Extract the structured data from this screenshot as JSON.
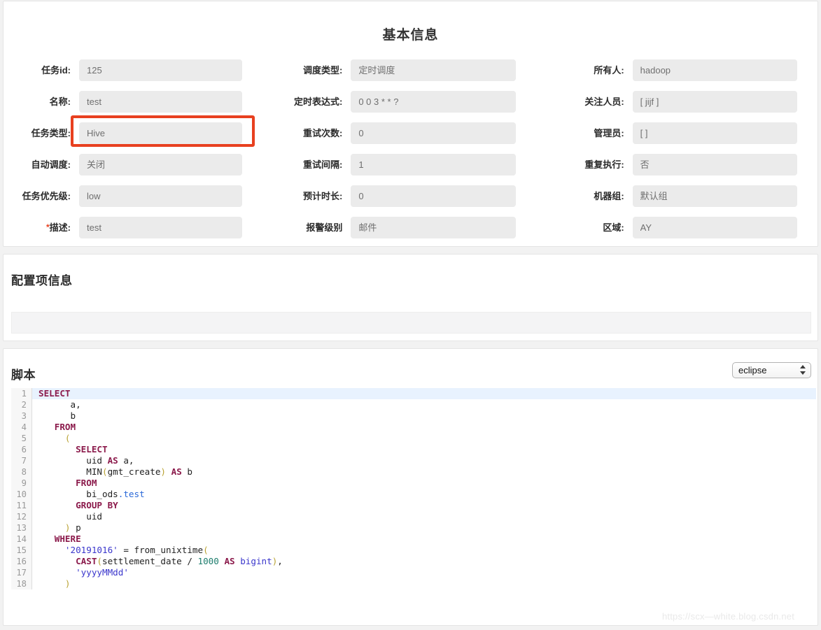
{
  "basic": {
    "title": "基本信息",
    "columns": [
      [
        {
          "label": "任务id:",
          "value": "125",
          "required": false,
          "name": "task-id"
        },
        {
          "label": "名称:",
          "value": "test",
          "required": false,
          "name": "task-name"
        },
        {
          "label": "任务类型:",
          "value": "Hive",
          "required": false,
          "name": "task-type"
        },
        {
          "label": "自动调度:",
          "value": "关闭",
          "required": false,
          "name": "auto-schedule"
        },
        {
          "label": "任务优先级:",
          "value": "low",
          "required": false,
          "name": "task-priority"
        },
        {
          "label": "描述:",
          "value": "test",
          "required": true,
          "name": "description"
        }
      ],
      [
        {
          "label": "调度类型:",
          "value": "定时调度",
          "required": false,
          "name": "schedule-type"
        },
        {
          "label": "定时表达式:",
          "value": "0 0 3 * * ?",
          "required": false,
          "name": "cron-expression"
        },
        {
          "label": "重试次数:",
          "value": "0",
          "required": false,
          "name": "retry-count"
        },
        {
          "label": "重试间隔:",
          "value": "1",
          "required": false,
          "name": "retry-interval"
        },
        {
          "label": "预计时长:",
          "value": "0",
          "required": false,
          "name": "estimated-duration"
        },
        {
          "label": "报警级别",
          "value": "邮件",
          "required": false,
          "name": "alarm-level"
        }
      ],
      [
        {
          "label": "所有人:",
          "value": "hadoop",
          "required": false,
          "name": "owner"
        },
        {
          "label": "关注人员:",
          "value": "[ jijf ]",
          "required": false,
          "name": "followers"
        },
        {
          "label": "管理员:",
          "value": "[ ]",
          "required": false,
          "name": "administrators"
        },
        {
          "label": "重复执行:",
          "value": "否",
          "required": false,
          "name": "repeat-execution"
        },
        {
          "label": "机器组:",
          "value": "默认组",
          "required": false,
          "name": "machine-group"
        },
        {
          "label": "区域:",
          "value": "AY",
          "required": false,
          "name": "region"
        }
      ]
    ],
    "highlight_color": "#e8401f"
  },
  "config": {
    "title": "配置项信息"
  },
  "script": {
    "title": "脚本",
    "theme": {
      "selected": "eclipse",
      "options": [
        "eclipse"
      ]
    },
    "code_lines": [
      {
        "n": "1",
        "tokens": [
          {
            "t": "SELECT",
            "c": "kw"
          }
        ]
      },
      {
        "n": "2",
        "tokens": [
          {
            "t": "      a,",
            "c": "fn"
          }
        ]
      },
      {
        "n": "3",
        "tokens": [
          {
            "t": "      b",
            "c": "fn"
          }
        ]
      },
      {
        "n": "4",
        "tokens": [
          {
            "t": "   ",
            "c": "fn"
          },
          {
            "t": "FROM",
            "c": "kw"
          }
        ]
      },
      {
        "n": "5",
        "tokens": [
          {
            "t": "     ",
            "c": "fn"
          },
          {
            "t": "(",
            "c": "par"
          }
        ]
      },
      {
        "n": "6",
        "tokens": [
          {
            "t": "       ",
            "c": "fn"
          },
          {
            "t": "SELECT",
            "c": "kw"
          }
        ]
      },
      {
        "n": "7",
        "tokens": [
          {
            "t": "         uid ",
            "c": "fn"
          },
          {
            "t": "AS",
            "c": "kw"
          },
          {
            "t": " a,",
            "c": "fn"
          }
        ]
      },
      {
        "n": "8",
        "tokens": [
          {
            "t": "         MIN",
            "c": "fn"
          },
          {
            "t": "(",
            "c": "par"
          },
          {
            "t": "gmt_create",
            "c": "fn"
          },
          {
            "t": ")",
            "c": "par"
          },
          {
            "t": " ",
            "c": "fn"
          },
          {
            "t": "AS",
            "c": "kw"
          },
          {
            "t": " b",
            "c": "fn"
          }
        ]
      },
      {
        "n": "9",
        "tokens": [
          {
            "t": "       ",
            "c": "fn"
          },
          {
            "t": "FROM",
            "c": "kw"
          }
        ]
      },
      {
        "n": "10",
        "tokens": [
          {
            "t": "         bi_ods",
            "c": "fn"
          },
          {
            "t": ".test",
            "c": "tbl"
          }
        ]
      },
      {
        "n": "11",
        "tokens": [
          {
            "t": "       ",
            "c": "fn"
          },
          {
            "t": "GROUP BY",
            "c": "kw"
          }
        ]
      },
      {
        "n": "12",
        "tokens": [
          {
            "t": "         uid",
            "c": "fn"
          }
        ]
      },
      {
        "n": "13",
        "tokens": [
          {
            "t": "     ",
            "c": "fn"
          },
          {
            "t": ")",
            "c": "par"
          },
          {
            "t": " p",
            "c": "fn"
          }
        ]
      },
      {
        "n": "14",
        "tokens": [
          {
            "t": "   ",
            "c": "fn"
          },
          {
            "t": "WHERE",
            "c": "kw"
          }
        ]
      },
      {
        "n": "15",
        "tokens": [
          {
            "t": "     ",
            "c": "fn"
          },
          {
            "t": "'20191016'",
            "c": "str"
          },
          {
            "t": " = from_unixtime",
            "c": "fn"
          },
          {
            "t": "(",
            "c": "par"
          }
        ]
      },
      {
        "n": "16",
        "tokens": [
          {
            "t": "       ",
            "c": "fn"
          },
          {
            "t": "CAST",
            "c": "kw"
          },
          {
            "t": "(",
            "c": "par"
          },
          {
            "t": "settlement_date / ",
            "c": "fn"
          },
          {
            "t": "1000",
            "c": "num"
          },
          {
            "t": " ",
            "c": "fn"
          },
          {
            "t": "AS",
            "c": "kw"
          },
          {
            "t": " ",
            "c": "fn"
          },
          {
            "t": "bigint",
            "c": "typ"
          },
          {
            "t": ")",
            "c": "par"
          },
          {
            "t": ",",
            "c": "fn"
          }
        ]
      },
      {
        "n": "17",
        "tokens": [
          {
            "t": "       ",
            "c": "fn"
          },
          {
            "t": "'yyyyMMdd'",
            "c": "str"
          }
        ]
      },
      {
        "n": "18",
        "tokens": [
          {
            "t": "     ",
            "c": "fn"
          },
          {
            "t": ")",
            "c": "par"
          }
        ]
      }
    ]
  },
  "watermark": "https://scx—white.blog.csdn.net"
}
